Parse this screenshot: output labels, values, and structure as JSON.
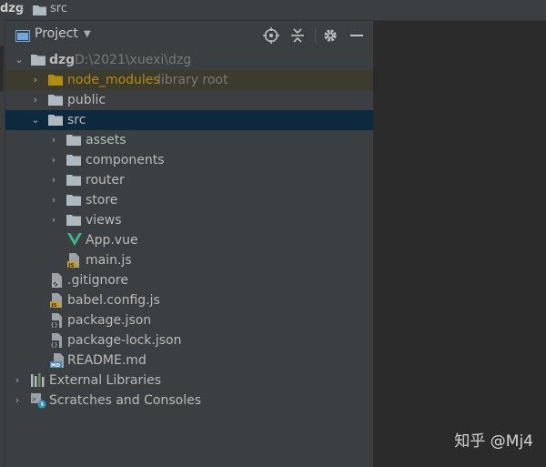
{
  "breadcrumb": {
    "project": "dzg",
    "folder": "src"
  },
  "panel": {
    "title": "Project"
  },
  "tree": {
    "root": {
      "name": "dzg",
      "path": "D:\\2021\\xuexi\\dzg"
    },
    "node_modules": {
      "name": "node_modules",
      "hint": "library root"
    },
    "public": "public",
    "src": "src",
    "assets": "assets",
    "components": "components",
    "router": "router",
    "store": "store",
    "views": "views",
    "app_vue": "App.vue",
    "main_js": "main.js",
    "gitignore": ".gitignore",
    "babel_config": "babel.config.js",
    "package_json": "package.json",
    "package_lock": "package-lock.json",
    "readme": "README.md",
    "external_libraries": "External Libraries",
    "scratches": "Scratches and Consoles"
  },
  "watermark": "知乎 @Mj4",
  "colors": {
    "panel": "#3c3f41",
    "editor": "#2b2b2b",
    "selection": "#0d293e",
    "library_row": "#3d3b2e",
    "node_modules_text": "#b38a12",
    "folder": "#aeb9c0",
    "vue_green": "#41b883"
  }
}
